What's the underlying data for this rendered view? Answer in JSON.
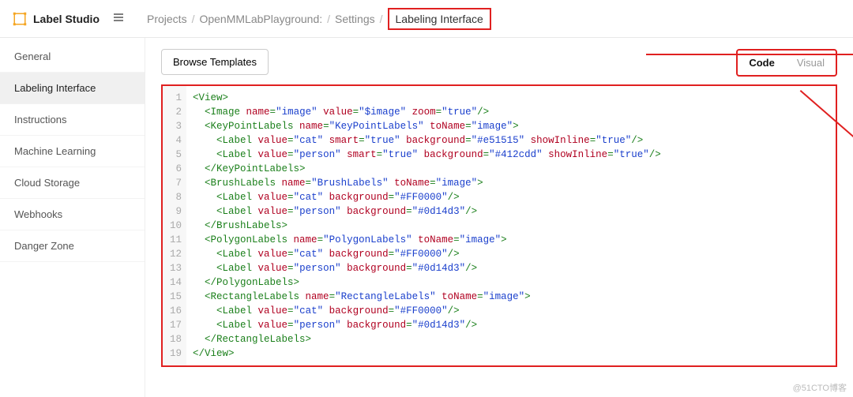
{
  "brand": {
    "name": "Label Studio"
  },
  "breadcrumbs": {
    "items": [
      "Projects",
      "OpenMMLabPlayground:",
      "Settings",
      "Labeling Interface"
    ]
  },
  "sidebar": {
    "items": [
      {
        "label": "General"
      },
      {
        "label": "Labeling Interface"
      },
      {
        "label": "Instructions"
      },
      {
        "label": "Machine Learning"
      },
      {
        "label": "Cloud Storage"
      },
      {
        "label": "Webhooks"
      },
      {
        "label": "Danger Zone"
      }
    ],
    "selected_index": 1
  },
  "toolbar": {
    "browse_templates": "Browse Templates",
    "tabs": {
      "code": "Code",
      "visual": "Visual",
      "active": "code"
    }
  },
  "editor": {
    "lines": [
      [
        [
          "<",
          "punc"
        ],
        [
          "View",
          "tag"
        ],
        [
          ">",
          "punc"
        ]
      ],
      [
        [
          "  <",
          "punc"
        ],
        [
          "Image",
          "tag"
        ],
        [
          " name",
          "attr"
        ],
        [
          "=",
          "punc"
        ],
        [
          "\"image\"",
          "val"
        ],
        [
          " value",
          "attr"
        ],
        [
          "=",
          "punc"
        ],
        [
          "\"$image\"",
          "val"
        ],
        [
          " zoom",
          "attr"
        ],
        [
          "=",
          "punc"
        ],
        [
          "\"true\"",
          "val"
        ],
        [
          "/>",
          "punc"
        ]
      ],
      [
        [
          "  <",
          "punc"
        ],
        [
          "KeyPointLabels",
          "tag"
        ],
        [
          " name",
          "attr"
        ],
        [
          "=",
          "punc"
        ],
        [
          "\"KeyPointLabels\"",
          "val"
        ],
        [
          " toName",
          "attr"
        ],
        [
          "=",
          "punc"
        ],
        [
          "\"image\"",
          "val"
        ],
        [
          ">",
          "punc"
        ]
      ],
      [
        [
          "    <",
          "punc"
        ],
        [
          "Label",
          "tag"
        ],
        [
          " value",
          "attr"
        ],
        [
          "=",
          "punc"
        ],
        [
          "\"cat\"",
          "val"
        ],
        [
          " smart",
          "attr"
        ],
        [
          "=",
          "punc"
        ],
        [
          "\"true\"",
          "val"
        ],
        [
          " background",
          "attr"
        ],
        [
          "=",
          "punc"
        ],
        [
          "\"#e51515\"",
          "val"
        ],
        [
          " showInline",
          "attr"
        ],
        [
          "=",
          "punc"
        ],
        [
          "\"true\"",
          "val"
        ],
        [
          "/>",
          "punc"
        ]
      ],
      [
        [
          "    <",
          "punc"
        ],
        [
          "Label",
          "tag"
        ],
        [
          " value",
          "attr"
        ],
        [
          "=",
          "punc"
        ],
        [
          "\"person\"",
          "val"
        ],
        [
          " smart",
          "attr"
        ],
        [
          "=",
          "punc"
        ],
        [
          "\"true\"",
          "val"
        ],
        [
          " background",
          "attr"
        ],
        [
          "=",
          "punc"
        ],
        [
          "\"#412cdd\"",
          "val"
        ],
        [
          " showInline",
          "attr"
        ],
        [
          "=",
          "punc"
        ],
        [
          "\"true\"",
          "val"
        ],
        [
          "/>",
          "punc"
        ]
      ],
      [
        [
          "  </",
          "punc"
        ],
        [
          "KeyPointLabels",
          "tag"
        ],
        [
          ">",
          "punc"
        ]
      ],
      [
        [
          "  <",
          "punc"
        ],
        [
          "BrushLabels",
          "tag"
        ],
        [
          " name",
          "attr"
        ],
        [
          "=",
          "punc"
        ],
        [
          "\"BrushLabels\"",
          "val"
        ],
        [
          " toName",
          "attr"
        ],
        [
          "=",
          "punc"
        ],
        [
          "\"image\"",
          "val"
        ],
        [
          ">",
          "punc"
        ]
      ],
      [
        [
          "    <",
          "punc"
        ],
        [
          "Label",
          "tag"
        ],
        [
          " value",
          "attr"
        ],
        [
          "=",
          "punc"
        ],
        [
          "\"cat\"",
          "val"
        ],
        [
          " background",
          "attr"
        ],
        [
          "=",
          "punc"
        ],
        [
          "\"#FF0000\"",
          "val"
        ],
        [
          "/>",
          "punc"
        ]
      ],
      [
        [
          "    <",
          "punc"
        ],
        [
          "Label",
          "tag"
        ],
        [
          " value",
          "attr"
        ],
        [
          "=",
          "punc"
        ],
        [
          "\"person\"",
          "val"
        ],
        [
          " background",
          "attr"
        ],
        [
          "=",
          "punc"
        ],
        [
          "\"#0d14d3\"",
          "val"
        ],
        [
          "/>",
          "punc"
        ]
      ],
      [
        [
          "  </",
          "punc"
        ],
        [
          "BrushLabels",
          "tag"
        ],
        [
          ">",
          "punc"
        ]
      ],
      [
        [
          "  <",
          "punc"
        ],
        [
          "PolygonLabels",
          "tag"
        ],
        [
          " name",
          "attr"
        ],
        [
          "=",
          "punc"
        ],
        [
          "\"PolygonLabels\"",
          "val"
        ],
        [
          " toName",
          "attr"
        ],
        [
          "=",
          "punc"
        ],
        [
          "\"image\"",
          "val"
        ],
        [
          ">",
          "punc"
        ]
      ],
      [
        [
          "    <",
          "punc"
        ],
        [
          "Label",
          "tag"
        ],
        [
          " value",
          "attr"
        ],
        [
          "=",
          "punc"
        ],
        [
          "\"cat\"",
          "val"
        ],
        [
          " background",
          "attr"
        ],
        [
          "=",
          "punc"
        ],
        [
          "\"#FF0000\"",
          "val"
        ],
        [
          "/>",
          "punc"
        ]
      ],
      [
        [
          "    <",
          "punc"
        ],
        [
          "Label",
          "tag"
        ],
        [
          " value",
          "attr"
        ],
        [
          "=",
          "punc"
        ],
        [
          "\"person\"",
          "val"
        ],
        [
          " background",
          "attr"
        ],
        [
          "=",
          "punc"
        ],
        [
          "\"#0d14d3\"",
          "val"
        ],
        [
          "/>",
          "punc"
        ]
      ],
      [
        [
          "  </",
          "punc"
        ],
        [
          "PolygonLabels",
          "tag"
        ],
        [
          ">",
          "punc"
        ]
      ],
      [
        [
          "  <",
          "punc"
        ],
        [
          "RectangleLabels",
          "tag"
        ],
        [
          " name",
          "attr"
        ],
        [
          "=",
          "punc"
        ],
        [
          "\"RectangleLabels\"",
          "val"
        ],
        [
          " toName",
          "attr"
        ],
        [
          "=",
          "punc"
        ],
        [
          "\"image\"",
          "val"
        ],
        [
          ">",
          "punc"
        ]
      ],
      [
        [
          "    <",
          "punc"
        ],
        [
          "Label",
          "tag"
        ],
        [
          " value",
          "attr"
        ],
        [
          "=",
          "punc"
        ],
        [
          "\"cat\"",
          "val"
        ],
        [
          " background",
          "attr"
        ],
        [
          "=",
          "punc"
        ],
        [
          "\"#FF0000\"",
          "val"
        ],
        [
          "/>",
          "punc"
        ]
      ],
      [
        [
          "    <",
          "punc"
        ],
        [
          "Label",
          "tag"
        ],
        [
          " value",
          "attr"
        ],
        [
          "=",
          "punc"
        ],
        [
          "\"person\"",
          "val"
        ],
        [
          " background",
          "attr"
        ],
        [
          "=",
          "punc"
        ],
        [
          "\"#0d14d3\"",
          "val"
        ],
        [
          "/>",
          "punc"
        ]
      ],
      [
        [
          "  </",
          "punc"
        ],
        [
          "RectangleLabels",
          "tag"
        ],
        [
          ">",
          "punc"
        ]
      ],
      [
        [
          "</",
          "punc"
        ],
        [
          "View",
          "tag"
        ],
        [
          ">",
          "punc"
        ]
      ]
    ]
  },
  "watermark": "@51CTO博客"
}
